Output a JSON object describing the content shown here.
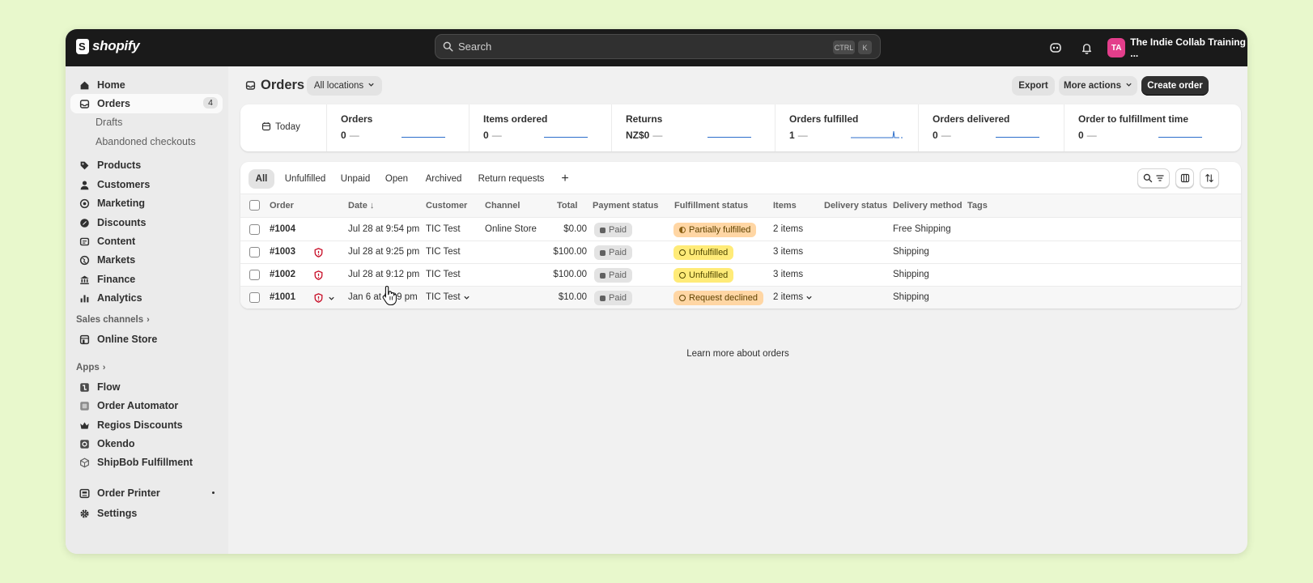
{
  "topbar": {
    "brand": "shopify",
    "search_placeholder": "Search",
    "shortcut_ctrl": "CTRL",
    "shortcut_key": "K",
    "avatar_initials": "TA",
    "store_name": "The Indie Collab Training ..."
  },
  "sidebar": {
    "items": [
      {
        "label": "Home",
        "icon": "home-icon"
      },
      {
        "label": "Orders",
        "icon": "orders-icon",
        "count": "4"
      },
      {
        "label": "Drafts"
      },
      {
        "label": "Abandoned checkouts"
      },
      {
        "label": "Products",
        "icon": "tag-icon"
      },
      {
        "label": "Customers",
        "icon": "person-icon"
      },
      {
        "label": "Marketing",
        "icon": "target-icon"
      },
      {
        "label": "Discounts",
        "icon": "discount-icon"
      },
      {
        "label": "Content",
        "icon": "content-icon"
      },
      {
        "label": "Markets",
        "icon": "globe-icon"
      },
      {
        "label": "Finance",
        "icon": "bank-icon"
      },
      {
        "label": "Analytics",
        "icon": "bar-chart-icon"
      }
    ],
    "sales_channels_label": "Sales channels",
    "online_store_label": "Online Store",
    "apps_label": "Apps",
    "apps": [
      {
        "label": "Flow"
      },
      {
        "label": "Order Automator"
      },
      {
        "label": "Regios Discounts"
      },
      {
        "label": "Okendo"
      },
      {
        "label": "ShipBob Fulfillment"
      }
    ],
    "order_printer_label": "Order Printer",
    "settings_label": "Settings"
  },
  "page": {
    "title": "Orders",
    "location_filter": "All locations",
    "export_label": "Export",
    "more_actions_label": "More actions",
    "create_order_label": "Create order"
  },
  "metrics": {
    "date_label": "Today",
    "items": [
      {
        "label": "Orders",
        "value": "0",
        "dash": "—"
      },
      {
        "label": "Items ordered",
        "value": "0",
        "dash": "—"
      },
      {
        "label": "Returns",
        "value": "NZ$0",
        "dash": "—"
      },
      {
        "label": "Orders fulfilled",
        "value": "1",
        "dash": "—"
      },
      {
        "label": "Orders delivered",
        "value": "0",
        "dash": "—"
      },
      {
        "label": "Order to fulfillment time",
        "value": "0",
        "dash": "—"
      }
    ]
  },
  "tabs": [
    "All",
    "Unfulfilled",
    "Unpaid",
    "Open",
    "Archived",
    "Return requests"
  ],
  "add_tab_label": "+",
  "table": {
    "headers": {
      "order": "Order",
      "date": "Date",
      "date_sort": "↓",
      "customer": "Customer",
      "channel": "Channel",
      "total": "Total",
      "payment_status": "Payment status",
      "fulfillment_status": "Fulfillment status",
      "items": "Items",
      "delivery_status": "Delivery status",
      "delivery_method": "Delivery method",
      "tags": "Tags"
    },
    "rows": [
      {
        "order": "#1004",
        "risk": false,
        "date": "Jul 28 at 9:54 pm",
        "customer": "TIC Test",
        "channel": "Online Store",
        "total": "$0.00",
        "payment": "Paid",
        "fulfillment": "Partially fulfilled",
        "items": "2 items",
        "delivery_method": "Free Shipping"
      },
      {
        "order": "#1003",
        "risk": true,
        "date": "Jul 28 at 9:25 pm",
        "customer": "TIC Test",
        "channel": "",
        "total": "$100.00",
        "payment": "Paid",
        "fulfillment": "Unfulfilled",
        "items": "3 items",
        "delivery_method": "Shipping"
      },
      {
        "order": "#1002",
        "risk": true,
        "date": "Jul 28 at 9:12 pm",
        "customer": "TIC Test",
        "channel": "",
        "total": "$100.00",
        "payment": "Paid",
        "fulfillment": "Unfulfilled",
        "items": "3 items",
        "delivery_method": "Shipping"
      },
      {
        "order": "#1001",
        "risk": true,
        "date": "Jan 6 at 6:09 pm",
        "customer": "TIC Test",
        "channel": "",
        "total": "$10.00",
        "payment": "Paid",
        "fulfillment": "Request declined",
        "items": "2 items",
        "delivery_method": "Shipping"
      }
    ]
  },
  "learn_more": "Learn more about orders",
  "colors": {
    "background": "#e8f8cc",
    "topbar": "#1a1a1a",
    "accent_dark": "#303030",
    "risk_red": "#c70a24",
    "sparkline": "#2c6ecb",
    "badge_orange": "#ffd6a4",
    "badge_yellow": "#ffeb78"
  }
}
